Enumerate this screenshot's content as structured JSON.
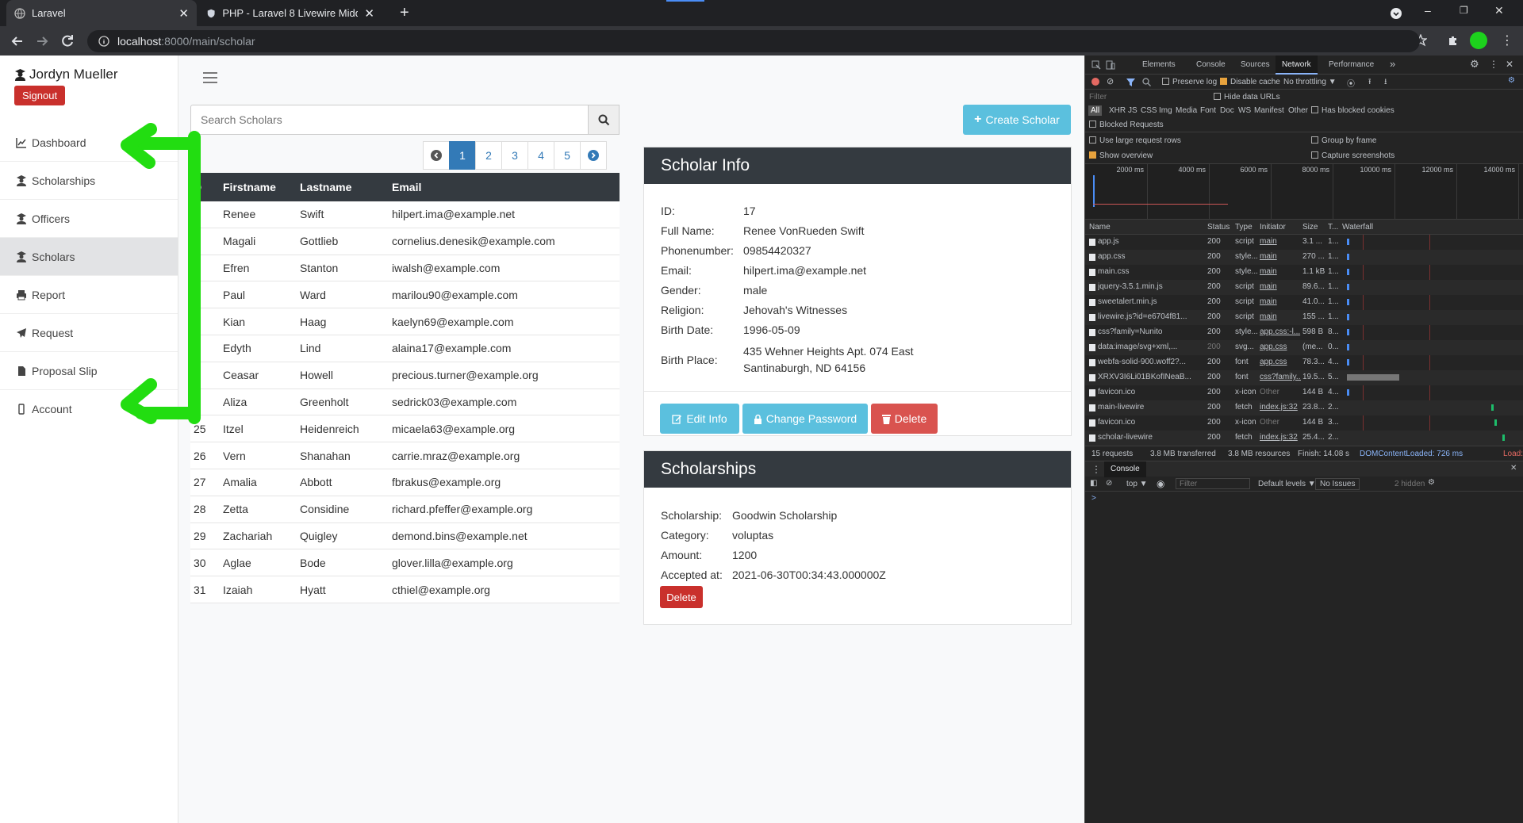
{
  "browser": {
    "tabs": [
      {
        "title": "Laravel",
        "active": true
      },
      {
        "title": "PHP - Laravel 8 Livewire Middlew",
        "active": false
      }
    ],
    "url_host": "localhost",
    "url_rest": ":8000/main/scholar",
    "new_tab": "+"
  },
  "sidebar": {
    "username": "Jordyn Mueller",
    "signout": "Signout",
    "items": [
      {
        "label": "Dashboard",
        "icon": "line-chart-icon"
      },
      {
        "label": "Scholarships",
        "icon": "user-graduate-icon"
      },
      {
        "label": "Officers",
        "icon": "user-graduate-icon"
      },
      {
        "label": "Scholars",
        "icon": "user-graduate-icon",
        "active": true
      },
      {
        "label": "Report",
        "icon": "print-icon"
      },
      {
        "label": "Request",
        "icon": "paper-plane-icon"
      },
      {
        "label": "Proposal Slip",
        "icon": "file-icon"
      },
      {
        "label": "Account",
        "icon": "mobile-icon"
      }
    ]
  },
  "search": {
    "placeholder": "Search Scholars"
  },
  "create_button": "Create Scholar",
  "pagination": {
    "pages": [
      "1",
      "2",
      "3",
      "4",
      "5"
    ],
    "current": "1"
  },
  "table": {
    "headers": [
      "D",
      "Firstname",
      "Lastname",
      "Email"
    ],
    "rows": [
      [
        "7",
        "Renee",
        "Swift",
        "hilpert.ima@example.net"
      ],
      [
        "8",
        "Magali",
        "Gottlieb",
        "cornelius.denesik@example.com"
      ],
      [
        "9",
        "Efren",
        "Stanton",
        "iwalsh@example.com"
      ],
      [
        "0",
        "Paul",
        "Ward",
        "marilou90@example.com"
      ],
      [
        "1",
        "Kian",
        "Haag",
        "kaelyn69@example.com"
      ],
      [
        "2",
        "Edyth",
        "Lind",
        "alaina17@example.com"
      ],
      [
        "3",
        "Ceasar",
        "Howell",
        "precious.turner@example.org"
      ],
      [
        "4",
        "Aliza",
        "Greenholt",
        "sedrick03@example.com"
      ],
      [
        "25",
        "Itzel",
        "Heidenreich",
        "micaela63@example.org"
      ],
      [
        "26",
        "Vern",
        "Shanahan",
        "carrie.mraz@example.org"
      ],
      [
        "27",
        "Amalia",
        "Abbott",
        "fbrakus@example.org"
      ],
      [
        "28",
        "Zetta",
        "Considine",
        "richard.pfeffer@example.org"
      ],
      [
        "29",
        "Zachariah",
        "Quigley",
        "demond.bins@example.net"
      ],
      [
        "30",
        "Aglae",
        "Bode",
        "glover.lilla@example.org"
      ],
      [
        "31",
        "Izaiah",
        "Hyatt",
        "cthiel@example.org"
      ]
    ]
  },
  "scholar_info": {
    "title": "Scholar Info",
    "fields": [
      {
        "key": "ID:",
        "value": "17"
      },
      {
        "key": "Full Name:",
        "value": "Renee VonRueden Swift"
      },
      {
        "key": "Phonenumber:",
        "value": "09854420327"
      },
      {
        "key": "Email:",
        "value": "hilpert.ima@example.net"
      },
      {
        "key": "Gender:",
        "value": "male"
      },
      {
        "key": "Religion:",
        "value": "Jehovah's Witnesses"
      },
      {
        "key": "Birth Date:",
        "value": "1996-05-09"
      },
      {
        "key": "Birth Place:",
        "value": "435 Wehner Heights Apt. 074 East Santinaburgh, ND 64156"
      }
    ],
    "edit": "Edit Info",
    "change_password": "Change Password",
    "delete": "Delete"
  },
  "scholarships": {
    "title": "Scholarships",
    "fields": [
      {
        "key": "Scholarship:",
        "value": "Goodwin Scholarship"
      },
      {
        "key": "Category:",
        "value": "voluptas"
      },
      {
        "key": "Amount:",
        "value": "1200"
      },
      {
        "key": "Accepted at:",
        "value": "2021-06-30T00:34:43.000000Z"
      }
    ],
    "delete": "Delete"
  },
  "devtools": {
    "tabs": [
      "Elements",
      "Console",
      "Sources",
      "Network",
      "Performance"
    ],
    "active_tab": "Network",
    "more": "»",
    "toolbar": {
      "preserve_log": "Preserve log",
      "disable_cache": "Disable cache",
      "throttle": "No throttling"
    },
    "filter_placeholder": "Filter",
    "hide_data_urls": "Hide data URLs",
    "types": [
      "All",
      "XHR",
      "JS",
      "CSS",
      "Img",
      "Media",
      "Font",
      "Doc",
      "WS",
      "Manifest",
      "Other"
    ],
    "has_blocked_cookies": "Has blocked cookies",
    "blocked_requests": "Blocked Requests",
    "use_large_rows": "Use large request rows",
    "group_by_frame": "Group by frame",
    "show_overview": "Show overview",
    "capture_screenshots": "Capture screenshots",
    "timeline_ticks": [
      "2000 ms",
      "4000 ms",
      "6000 ms",
      "8000 ms",
      "10000 ms",
      "12000 ms",
      "14000 ms"
    ],
    "columns": [
      "Name",
      "Status",
      "Type",
      "Initiator",
      "Size",
      "T...",
      "Waterfall"
    ],
    "requests": [
      [
        "app.js",
        "200",
        "script",
        "main",
        "3.1 ...",
        "1..."
      ],
      [
        "app.css",
        "200",
        "style...",
        "main",
        "270 ...",
        "1..."
      ],
      [
        "main.css",
        "200",
        "style...",
        "main",
        "1.1 kB",
        "1..."
      ],
      [
        "jquery-3.5.1.min.js",
        "200",
        "script",
        "main",
        "89.6...",
        "1..."
      ],
      [
        "sweetalert.min.js",
        "200",
        "script",
        "main",
        "41.0...",
        "1..."
      ],
      [
        "livewire.js?id=e6704f81...",
        "200",
        "script",
        "main",
        "155 ...",
        "1..."
      ],
      [
        "css?family=Nunito",
        "200",
        "style...",
        "app.css:-l...",
        "598 B",
        "8..."
      ],
      [
        "data:image/svg+xml,...",
        "200",
        "svg...",
        "app.css",
        "(me...",
        "0..."
      ],
      [
        "webfa-solid-900.woff2?...",
        "200",
        "font",
        "app.css",
        "78.3...",
        "4..."
      ],
      [
        "XRXV3I6Li01BKofINeaB...",
        "200",
        "font",
        "css?family...",
        "19.5...",
        "5..."
      ],
      [
        "favicon.ico",
        "200",
        "x-icon",
        "Other",
        "144 B",
        "4..."
      ],
      [
        "main-livewire",
        "200",
        "fetch",
        "index.js:32",
        "23.8...",
        "2..."
      ],
      [
        "favicon.ico",
        "200",
        "x-icon",
        "Other",
        "144 B",
        "3..."
      ],
      [
        "scholar-livewire",
        "200",
        "fetch",
        "index.js:32",
        "25.4...",
        "2..."
      ]
    ],
    "summary": {
      "requests": "15 requests",
      "transferred": "3.8 MB transferred",
      "resources": "3.8 MB resources",
      "finish": "Finish: 14.08 s",
      "dcl": "DOMContentLoaded: 726 ms",
      "load": "Load:"
    },
    "drawer": {
      "tab": "Console",
      "context": "top",
      "filter": "Filter",
      "levels": "Default levels",
      "issues": "No Issues",
      "hidden": "2 hidden",
      "prompt": ">"
    }
  },
  "colors": {
    "annotation_arrow": "#22dd11",
    "signout": "#c9302c",
    "primary": "#337ab7",
    "info": "#5bc0de",
    "danger": "#d9534f"
  }
}
